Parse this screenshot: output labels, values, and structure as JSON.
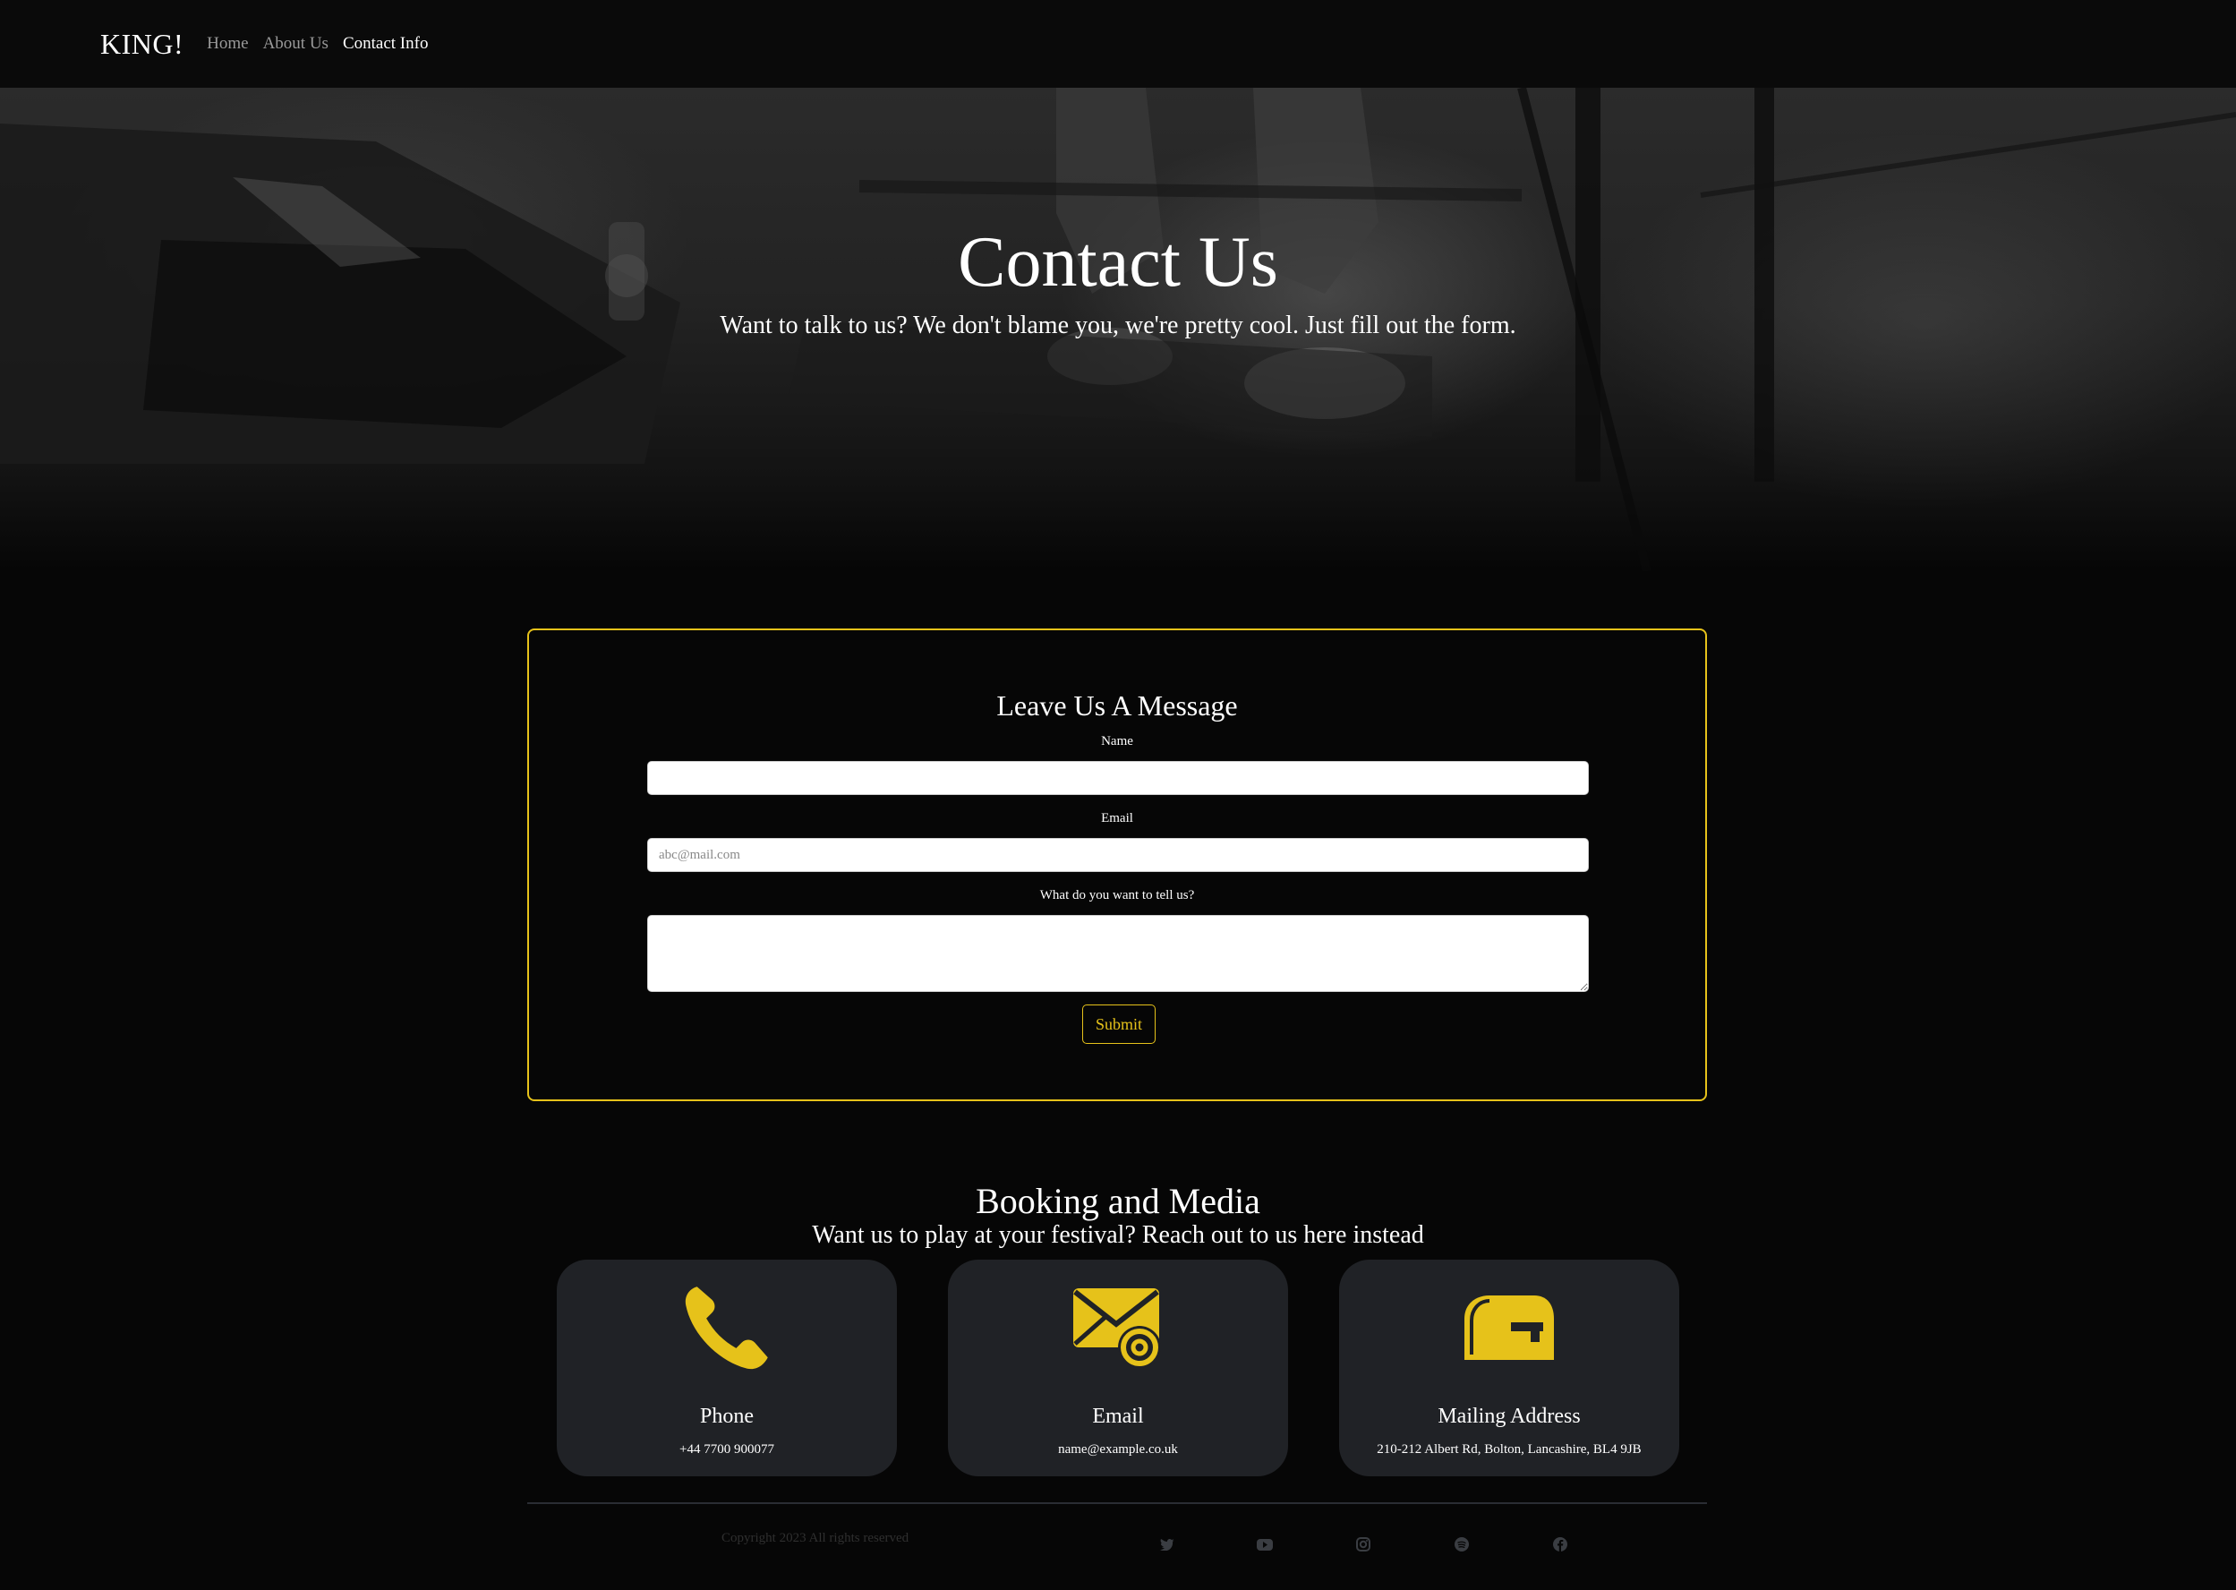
{
  "nav": {
    "brand": "KING!",
    "links": [
      {
        "label": "Home",
        "active": false
      },
      {
        "label": "About Us",
        "active": false
      },
      {
        "label": "Contact Info",
        "active": true
      }
    ]
  },
  "hero": {
    "title": "Contact Us",
    "subtitle": "Want to talk to us? We don't blame you, we're pretty cool. Just fill out the form."
  },
  "form": {
    "title": "Leave Us A Message",
    "name_label": "Name",
    "name_value": "",
    "email_label": "Email",
    "email_placeholder": "abc@mail.com",
    "message_label": "What do you want to tell us?",
    "submit_label": "Submit"
  },
  "booking": {
    "title": "Booking and Media",
    "subtitle": "Want us to play at your festival? Reach out to us here instead",
    "cards": [
      {
        "title": "Phone",
        "value": "+44 7700 900077",
        "icon": "phone-icon"
      },
      {
        "title": "Email",
        "value": "name@example.co.uk",
        "icon": "email-at-icon"
      },
      {
        "title": "Mailing Address",
        "value": "210-212 Albert Rd, Bolton, Lancashire, BL4 9JB",
        "icon": "mailbox-icon"
      }
    ]
  },
  "footer": {
    "copyright": "Copyright 2023 All rights reserved",
    "social": [
      "twitter-icon",
      "youtube-icon",
      "instagram-icon",
      "spotify-icon",
      "facebook-icon"
    ]
  },
  "colors": {
    "accent": "#e6c21a",
    "background": "#060606",
    "card": "#202226"
  }
}
